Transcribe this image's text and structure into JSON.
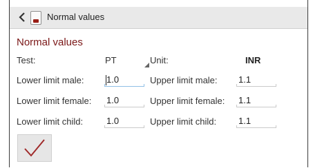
{
  "header": {
    "title": "Normal values",
    "back_icon": "chevron-left-icon",
    "app_icon": "calendar-book-icon"
  },
  "section_title": "Normal values",
  "test": {
    "label": "Test:",
    "value": "PT"
  },
  "unit": {
    "label": "Unit:",
    "value": "INR"
  },
  "rows": [
    {
      "lower_label": "Lower limit male:",
      "lower_value": "1.0",
      "upper_label": "Upper limit male:",
      "upper_value": "1.1"
    },
    {
      "lower_label": "Lower limit female:",
      "lower_value": "1.0",
      "upper_label": "Upper limit female:",
      "upper_value": "1.1"
    },
    {
      "lower_label": "Lower limit child:",
      "lower_value": "1.0",
      "upper_label": "Upper limit child:",
      "upper_value": "1.1"
    }
  ],
  "confirm_icon": "checkmark-icon",
  "colors": {
    "accent": "#7a1717",
    "checkmark": "#a02a2a",
    "focus_line": "#8fbfe6"
  }
}
